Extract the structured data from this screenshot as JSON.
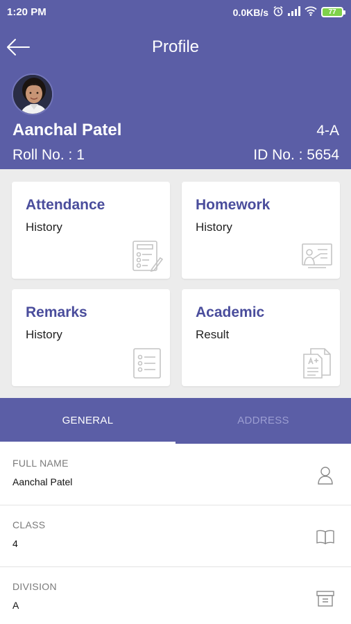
{
  "status_bar": {
    "time": "1:20 PM",
    "network_speed": "0.0KB/s",
    "battery": "77"
  },
  "header": {
    "title": "Profile",
    "student_name": "Aanchal Patel",
    "class_division": "4-A",
    "roll_text": "Roll No. : 1",
    "id_text": "ID No. : 5654"
  },
  "cards": [
    {
      "title": "Attendance",
      "subtitle": "History",
      "icon": "attendance-checklist-icon"
    },
    {
      "title": "Homework",
      "subtitle": "History",
      "icon": "homework-board-icon"
    },
    {
      "title": "Remarks",
      "subtitle": "History",
      "icon": "remarks-list-icon"
    },
    {
      "title": "Academic",
      "subtitle": "Result",
      "icon": "academic-result-icon"
    }
  ],
  "tabs": [
    {
      "label": "GENERAL",
      "active": true
    },
    {
      "label": "ADDRESS",
      "active": false
    }
  ],
  "fields": [
    {
      "label": "FULL NAME",
      "value": "Aanchal Patel",
      "icon": "person-icon"
    },
    {
      "label": "CLASS",
      "value": "4",
      "icon": "book-icon"
    },
    {
      "label": "DIVISION",
      "value": "A",
      "icon": "archive-box-icon"
    }
  ],
  "colors": {
    "primary": "#5b5ea6",
    "accent_text": "#4a4d9c",
    "background": "#ececec",
    "battery": "#7fd14a"
  }
}
